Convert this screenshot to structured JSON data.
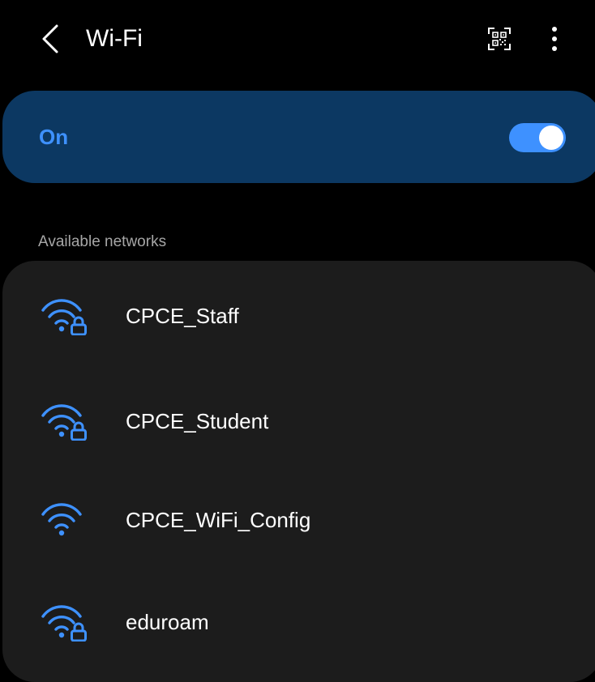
{
  "header": {
    "title": "Wi-Fi",
    "back_icon": "chevron-left-icon",
    "qr_icon": "qr-code-icon",
    "more_icon": "more-vertical-icon"
  },
  "wifi_toggle": {
    "label": "On",
    "state": true
  },
  "networks_section": {
    "header": "Available networks",
    "items": [
      {
        "name": "CPCE_Staff",
        "secured": true,
        "icon": "wifi-lock-icon"
      },
      {
        "name": "CPCE_Student",
        "secured": true,
        "icon": "wifi-lock-icon"
      },
      {
        "name": "CPCE_WiFi_Config",
        "secured": false,
        "icon": "wifi-icon"
      },
      {
        "name": "eduroam",
        "secured": true,
        "icon": "wifi-lock-icon"
      }
    ]
  },
  "colors": {
    "background": "#000000",
    "accent": "#3e91ff",
    "toggle_card": "#0c3862",
    "list_card": "#1c1c1c",
    "secondary_text": "#a6a6a6"
  }
}
